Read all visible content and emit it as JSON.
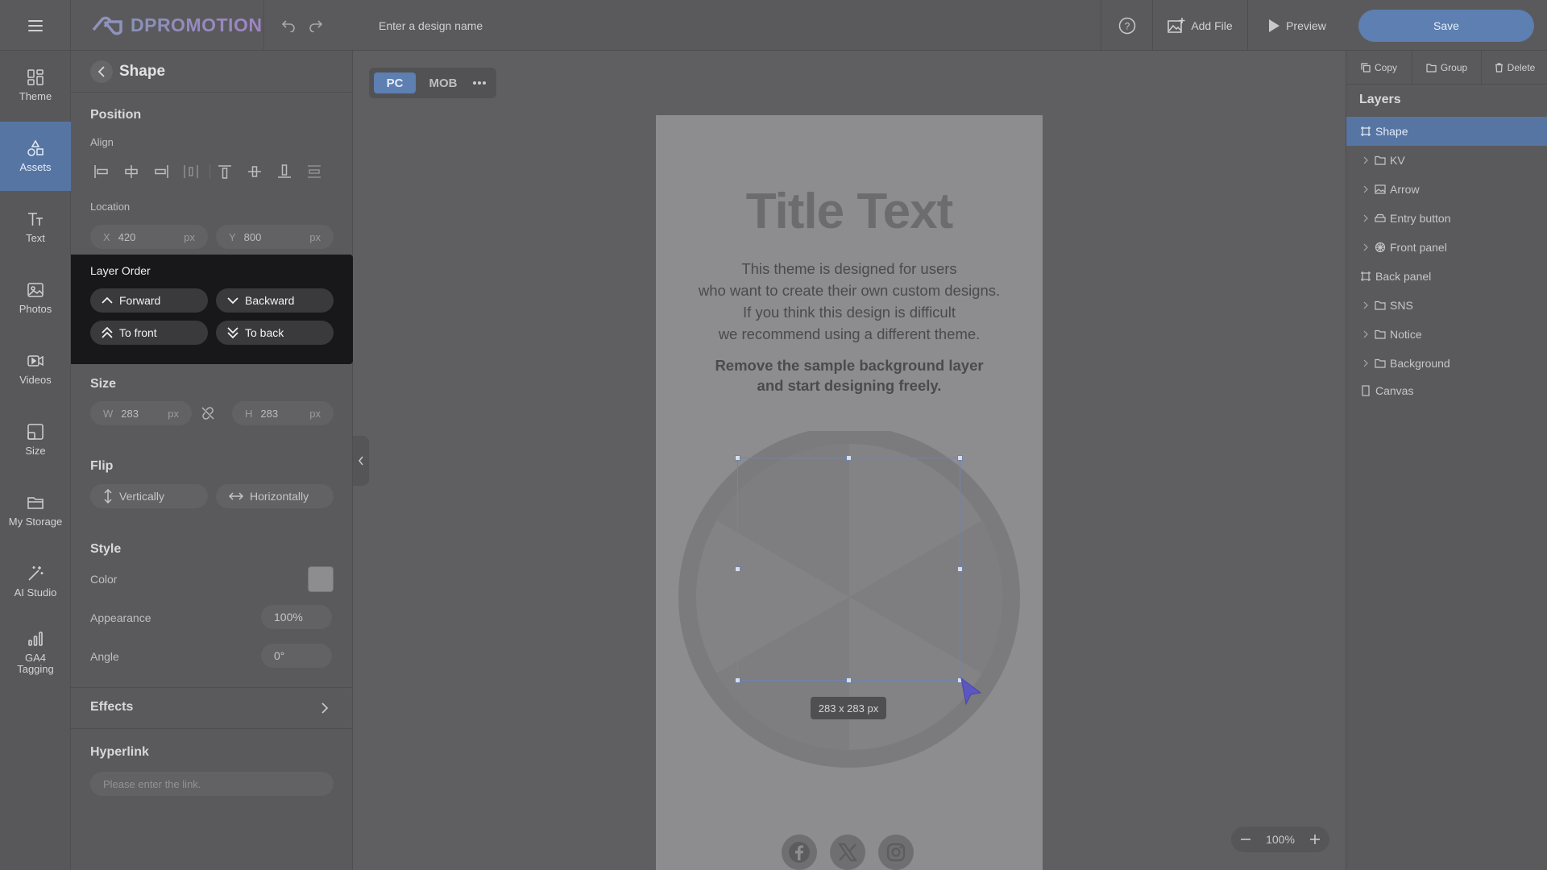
{
  "app": {
    "logo_text": "DPROMOTION",
    "design_name_placeholder": "Enter a design name",
    "add_file_label": "Add File",
    "preview_label": "Preview",
    "save_label": "Save"
  },
  "rail": {
    "items": [
      {
        "label": "Theme",
        "icon": "theme-icon"
      },
      {
        "label": "Assets",
        "icon": "assets-icon",
        "active": true
      },
      {
        "label": "Text",
        "icon": "text-icon"
      },
      {
        "label": "Photos",
        "icon": "photos-icon"
      },
      {
        "label": "Videos",
        "icon": "videos-icon"
      },
      {
        "label": "Size",
        "icon": "size-icon"
      },
      {
        "label": "My Storage",
        "icon": "folder-icon"
      },
      {
        "label": "AI Studio",
        "icon": "magic-wand-icon"
      },
      {
        "label": "GA4 Tagging",
        "icon": "analytics-icon"
      }
    ]
  },
  "panel": {
    "title": "Shape",
    "position": {
      "title": "Position",
      "align_label": "Align",
      "location_label": "Location",
      "x_prefix": "X",
      "x_value": "420",
      "y_prefix": "Y",
      "y_value": "800",
      "unit": "px"
    },
    "layer_order": {
      "title": "Layer Order",
      "forward": "Forward",
      "backward": "Backward",
      "to_front": "To front",
      "to_back": "To back"
    },
    "size": {
      "title": "Size",
      "w_prefix": "W",
      "w_value": "283",
      "h_prefix": "H",
      "h_value": "283",
      "unit": "px"
    },
    "flip": {
      "title": "Flip",
      "vertically": "Vertically",
      "horizontally": "Horizontally"
    },
    "style": {
      "title": "Style",
      "color_label": "Color",
      "color_value": "#8d8d90",
      "appearance_label": "Appearance",
      "appearance_value": "100%",
      "angle_label": "Angle",
      "angle_value": "0°"
    },
    "effects_label": "Effects",
    "hyperlink": {
      "title": "Hyperlink",
      "placeholder": "Please enter the link."
    }
  },
  "canvas": {
    "device_pc": "PC",
    "device_mob": "MOB",
    "title_text": "Title Text",
    "description_lines": [
      "This theme is designed for users",
      "who want to create their own custom designs.",
      "If you think this design is difficult",
      "we recommend using a different theme."
    ],
    "bold_lines": [
      "Remove the sample background layer",
      "and start designing freely."
    ],
    "size_tooltip": "283 x 283 px",
    "zoom_value": "100%"
  },
  "right_panel": {
    "copy_label": "Copy",
    "group_label": "Group",
    "delete_label": "Delete",
    "layers_title": "Layers",
    "layers": [
      {
        "name": "Shape",
        "icon": "shape-icon",
        "selected": true,
        "expandable": false
      },
      {
        "name": "KV",
        "icon": "folder-icon",
        "expandable": true
      },
      {
        "name": "Arrow",
        "icon": "image-icon",
        "expandable": true
      },
      {
        "name": "Entry button",
        "icon": "button-icon",
        "expandable": true
      },
      {
        "name": "Front panel",
        "icon": "wheel-icon",
        "expandable": true
      },
      {
        "name": "Back panel",
        "icon": "shape-icon",
        "expandable": false
      },
      {
        "name": "SNS",
        "icon": "folder-icon",
        "expandable": true
      },
      {
        "name": "Notice",
        "icon": "folder-icon",
        "expandable": true
      },
      {
        "name": "Background",
        "icon": "folder-icon",
        "expandable": true
      },
      {
        "name": "Canvas",
        "icon": "canvas-icon",
        "expandable": false
      }
    ]
  },
  "colors": {
    "accent": "#5d7fb1",
    "background": "#5f5f62",
    "panel": "#5a5a5d"
  }
}
